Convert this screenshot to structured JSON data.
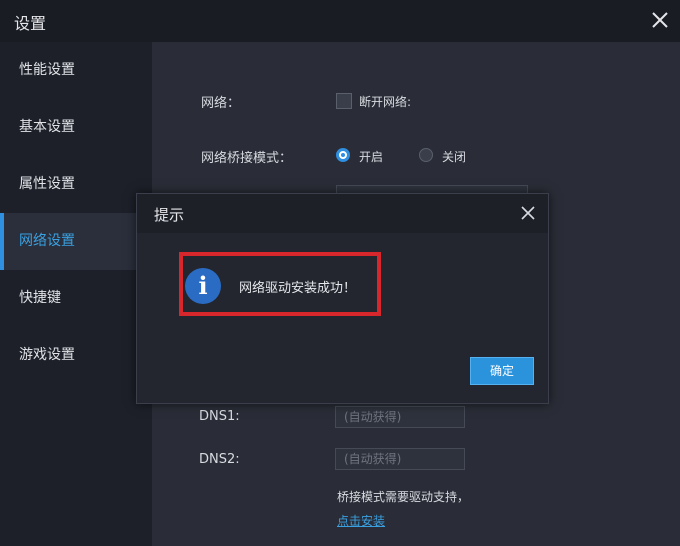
{
  "window": {
    "title": "设置"
  },
  "sidebar": {
    "items": [
      {
        "label": "性能设置"
      },
      {
        "label": "基本设置"
      },
      {
        "label": "属性设置"
      },
      {
        "label": "网络设置",
        "active": true
      },
      {
        "label": "快捷键"
      },
      {
        "label": "游戏设置"
      }
    ]
  },
  "network": {
    "network_label": "网络：",
    "disconnect_label": "断开网络:",
    "disconnect_checked": false,
    "bridge_label": "网络桥接模式：",
    "bridge_on_label": "开启",
    "bridge_off_label": "关闭",
    "bridge_selected": "开启",
    "dns1_label": "DNS1:",
    "dns1_placeholder": "(自动获得)",
    "dns2_label": "DNS2:",
    "dns2_placeholder": "(自动获得)",
    "driver_note": "桥接模式需要驱动支持，",
    "install_link": "点击安装"
  },
  "dialog": {
    "title": "提示",
    "message": "网络驱动安装成功！",
    "ok_label": "确定",
    "info_glyph": "i"
  },
  "colors": {
    "accent": "#2f8fe0",
    "highlight_border": "#d8262d",
    "info_icon": "#2a6cc4"
  }
}
